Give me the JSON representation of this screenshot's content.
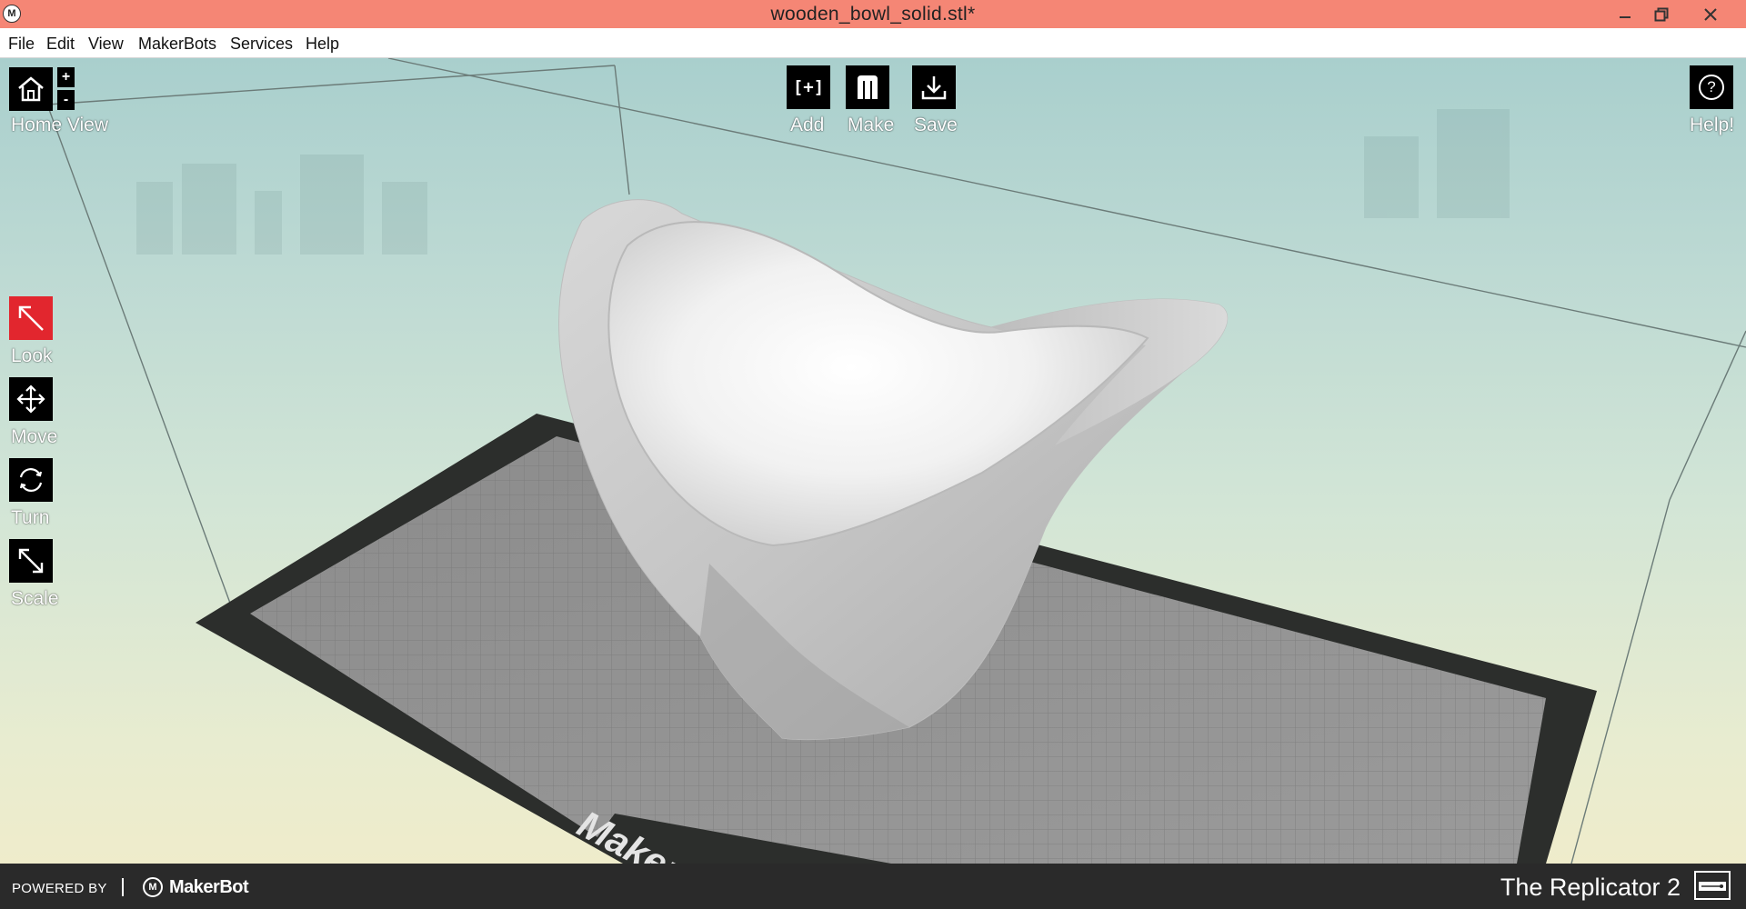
{
  "window": {
    "title": "wooden_bowl_solid.stl*",
    "app_logo": "M",
    "buttons": {
      "minimize": "minimize-icon",
      "restore": "restore-icon",
      "close": "close-icon"
    }
  },
  "menu": [
    "File",
    "Edit",
    "View",
    "MakerBots",
    "Services",
    "Help"
  ],
  "toolbar": {
    "home_view": "Home View",
    "zoom_in": "+",
    "zoom_out": "-",
    "add": "Add",
    "add_icon_text": "[+]",
    "make": "Make",
    "save": "Save",
    "help": "Help!",
    "help_icon_text": "?"
  },
  "tools": {
    "look": "Look",
    "move": "Move",
    "turn": "Turn",
    "scale": "Scale"
  },
  "plate_brand": "MakerBot",
  "status": {
    "powered_by": "POWERED BY",
    "brand": "MakerBot",
    "printer": "The Replicator 2"
  },
  "colors": {
    "titlebar": "#f58675",
    "active_tool": "#e2262e",
    "statusbar": "#2a2a2a"
  }
}
